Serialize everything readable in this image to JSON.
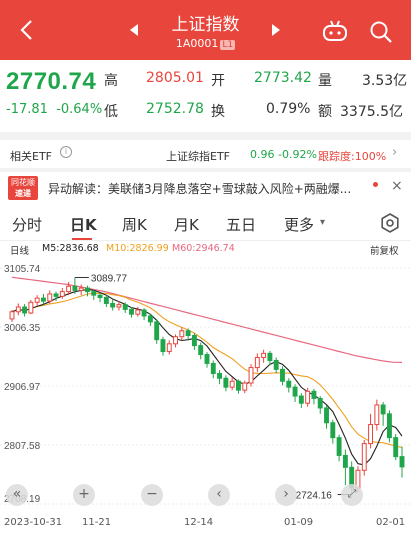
{
  "header": {
    "title": "上证指数",
    "code": "1A0001",
    "level_badge": "L1",
    "bg_color": "#e8453c"
  },
  "quote": {
    "price": "2770.74",
    "change": "-17.81",
    "change_pct": "-0.64%",
    "high_label": "高",
    "high": "2805.01",
    "low_label": "低",
    "low": "2752.78",
    "open_label": "开",
    "open": "2773.42",
    "turnover_label": "换",
    "turnover": "0.79%",
    "volume_label": "量",
    "volume": "3.53亿",
    "amount_label": "额",
    "amount": "3375.5亿"
  },
  "etf": {
    "label": "相关ETF",
    "name": "上证综指ETF",
    "price": "0.96",
    "pct": "-0.92%",
    "tracking_label": "跟踪度:100%"
  },
  "news": {
    "badge_top": "同花顺",
    "badge_bottom": "速递",
    "text": "异动解读：美联储3月降息落空+雪球敲入风险+两融爆..."
  },
  "tabs": [
    "分时",
    "日K",
    "周K",
    "月K",
    "五日",
    "更多"
  ],
  "active_tab": "日K",
  "ma_row": {
    "label": "日线",
    "m5": "M5:2836.68",
    "m10": "M10:2826.99",
    "m60": "M60:2946.74",
    "adjust": "前复权"
  },
  "chart_data": {
    "type": "candlestick",
    "y_ticks": [
      "3105.74",
      "3006.35",
      "2906.97",
      "2807.58",
      "2708.19"
    ],
    "y_tick_values": [
      3105.74,
      3006.35,
      2906.97,
      2807.58,
      2708.19
    ],
    "ylim": [
      2708.19,
      3105.74
    ],
    "x_labels": [
      "2023-10-31",
      "11-21",
      "12-14",
      "01-09",
      "02-01"
    ],
    "max_annotation": "3089.77",
    "min_annotation": "2724.16",
    "colors": {
      "up": "#e8453c",
      "down": "#20a64a",
      "m5": "#222222",
      "m10": "#f0a020",
      "m60": "#e86880"
    },
    "candles": [
      [
        3020,
        3032,
        3015,
        3035
      ],
      [
        3032,
        3040,
        3026,
        3046
      ],
      [
        3040,
        3030,
        3024,
        3045
      ],
      [
        3030,
        3048,
        3028,
        3052
      ],
      [
        3048,
        3055,
        3042,
        3060
      ],
      [
        3055,
        3050,
        3044,
        3062
      ],
      [
        3050,
        3062,
        3046,
        3068
      ],
      [
        3062,
        3058,
        3050,
        3066
      ],
      [
        3058,
        3066,
        3054,
        3072
      ],
      [
        3066,
        3075,
        3060,
        3082
      ],
      [
        3075,
        3068,
        3062,
        3089.77
      ],
      [
        3068,
        3072,
        3060,
        3078
      ],
      [
        3072,
        3066,
        3058,
        3076
      ],
      [
        3066,
        3060,
        3052,
        3070
      ],
      [
        3060,
        3056,
        3048,
        3064
      ],
      [
        3056,
        3046,
        3040,
        3060
      ],
      [
        3046,
        3040,
        3034,
        3052
      ],
      [
        3040,
        3044,
        3034,
        3050
      ],
      [
        3044,
        3036,
        3030,
        3048
      ],
      [
        3036,
        3028,
        3022,
        3040
      ],
      [
        3028,
        3035,
        3024,
        3040
      ],
      [
        3035,
        3025,
        3018,
        3038
      ],
      [
        3025,
        3015,
        3008,
        3028
      ],
      [
        3015,
        2985,
        2978,
        3020
      ],
      [
        2985,
        2965,
        2958,
        2990
      ],
      [
        2965,
        2978,
        2960,
        2984
      ],
      [
        2978,
        2990,
        2972,
        2994
      ],
      [
        2990,
        3000,
        2984,
        3006
      ],
      [
        3000,
        2992,
        2984,
        3004
      ],
      [
        2992,
        2975,
        2968,
        2996
      ],
      [
        2975,
        2960,
        2952,
        2980
      ],
      [
        2960,
        2945,
        2938,
        2964
      ],
      [
        2945,
        2928,
        2920,
        2950
      ],
      [
        2928,
        2920,
        2910,
        2934
      ],
      [
        2920,
        2905,
        2898,
        2925
      ],
      [
        2905,
        2915,
        2900,
        2922
      ],
      [
        2915,
        2900,
        2894,
        2918
      ],
      [
        2900,
        2912,
        2895,
        2916
      ],
      [
        2912,
        2938,
        2906,
        2944
      ],
      [
        2938,
        2955,
        2930,
        2962
      ],
      [
        2955,
        2962,
        2946,
        2968
      ],
      [
        2962,
        2950,
        2942,
        2966
      ],
      [
        2950,
        2935,
        2928,
        2955
      ],
      [
        2935,
        2915,
        2908,
        2940
      ],
      [
        2915,
        2905,
        2896,
        2920
      ],
      [
        2905,
        2890,
        2880,
        2910
      ],
      [
        2890,
        2878,
        2870,
        2895
      ],
      [
        2878,
        2898,
        2872,
        2904
      ],
      [
        2898,
        2886,
        2876,
        2902
      ],
      [
        2886,
        2870,
        2860,
        2890
      ],
      [
        2870,
        2845,
        2835,
        2874
      ],
      [
        2845,
        2820,
        2810,
        2850
      ],
      [
        2820,
        2790,
        2780,
        2825
      ],
      [
        2790,
        2770,
        2740,
        2800
      ],
      [
        2770,
        2735,
        2724.16,
        2780
      ],
      [
        2735,
        2765,
        2728,
        2772
      ],
      [
        2765,
        2810,
        2756,
        2816
      ],
      [
        2810,
        2842,
        2802,
        2860
      ],
      [
        2842,
        2875,
        2832,
        2884
      ],
      [
        2875,
        2860,
        2840,
        2880
      ],
      [
        2860,
        2820,
        2812,
        2866
      ],
      [
        2820,
        2788,
        2782,
        2826
      ],
      [
        2788,
        2770.74,
        2752.78,
        2805.01
      ]
    ],
    "m60_line": [
      3090,
      3088,
      3086,
      3084,
      3082,
      3080,
      3078,
      3075,
      3072,
      3069,
      3066,
      3062,
      3058,
      3054,
      3050,
      3046,
      3042,
      3038,
      3034,
      3030,
      3026,
      3022,
      3018,
      3014,
      3010,
      3006,
      3002,
      2998,
      2994,
      2990,
      2986,
      2982,
      2978,
      2974,
      2970,
      2966,
      2962,
      2958,
      2955,
      2952,
      2949,
      2947,
      2946.74
    ]
  },
  "controls": {
    "scroll_left": "«",
    "zoom_in": "+",
    "zoom_out": "−",
    "step_left": "‹",
    "step_right": "›"
  }
}
